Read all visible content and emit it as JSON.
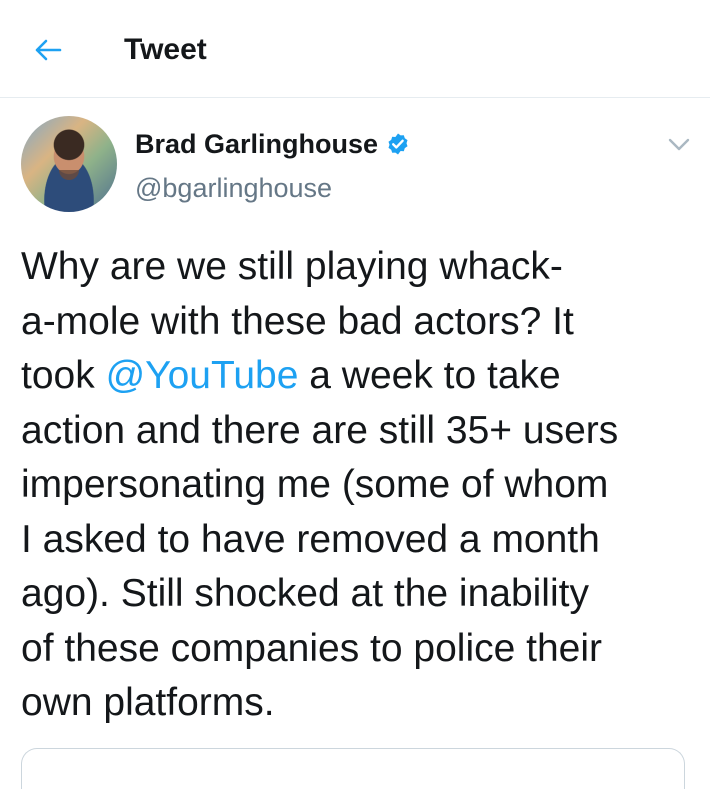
{
  "header": {
    "title": "Tweet"
  },
  "tweet": {
    "author_name": "Brad Garlinghouse",
    "author_handle": "@bgarlinghouse",
    "text": {
      "line1": "Why are we still playing whack-",
      "line2": "a-mole with these bad actors? It",
      "line3_before": "took ",
      "mention": "@YouTube",
      "line3_after": " a week to take",
      "line4": "action and there are still 35+ users",
      "line5": "impersonating me (some of whom",
      "line6": "I asked to have removed a month",
      "line7": "ago). Still shocked at the inability",
      "line8": "of these companies to police their",
      "line9": "own platforms."
    }
  },
  "colors": {
    "accent": "#1da1f2",
    "secondary_text": "#657786",
    "divider": "#e6ecf0"
  },
  "icons": {
    "back": "arrow-left-icon",
    "verified": "verified-badge-icon",
    "menu": "chevron-down-icon"
  }
}
